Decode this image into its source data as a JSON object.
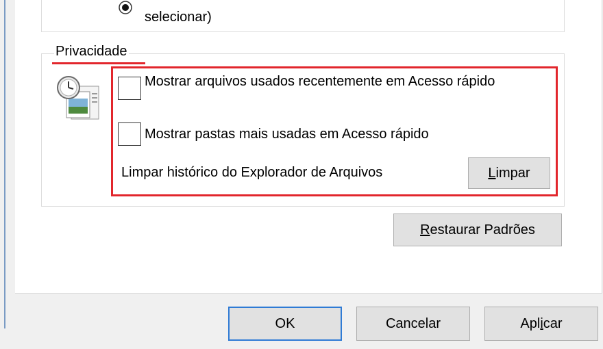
{
  "previous_option": {
    "text": "selecionar)"
  },
  "privacy": {
    "legend": "Privacidade",
    "show_recent_files_label": "Mostrar arquivos usados recentemente em Acesso rápido",
    "show_frequent_folders_label": "Mostrar pastas mais usadas em Acesso rápido",
    "clear_history_label": "Limpar histórico do Explorador de Arquivos",
    "clear_button": {
      "mnemonic": "L",
      "rest": "impar"
    },
    "show_recent_files_checked": false,
    "show_frequent_folders_checked": false
  },
  "restore_button": {
    "mnemonic": "R",
    "rest": "estaurar Padrões"
  },
  "dialog_buttons": {
    "ok": "OK",
    "cancel": "Cancelar",
    "apply": {
      "before": "Apl",
      "mnemonic": "i",
      "after": "car"
    }
  },
  "colors": {
    "highlight": "#e2262c",
    "focus": "#2f7bd5"
  }
}
